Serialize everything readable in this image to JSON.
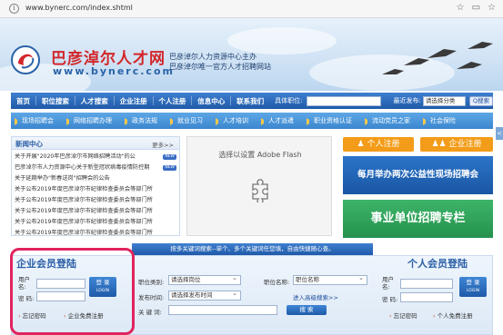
{
  "browser": {
    "url": "www.bynerc.com/index.shtml"
  },
  "header": {
    "logo_cn": "巴彦淖尔人才网",
    "logo_url": "www.bynerc.com",
    "tagline_1": "巴彦淖尔人力资源中心主办",
    "tagline_2": "巴彦淖尔唯一官方人才招聘网站"
  },
  "main_nav": {
    "items": [
      "首页",
      "职位搜索",
      "人才搜索",
      "企业注册",
      "个人注册",
      "信息中心",
      "联系我们"
    ],
    "position_label": "具体职位:",
    "date_label": "最近发布:",
    "category_select": "请选择分类",
    "search_btn": "Q搜索"
  },
  "sub_nav": {
    "items": [
      "现场招聘会",
      "网络招聘办理",
      "政务法规",
      "就业见习",
      "人才培训",
      "人才派遣",
      "职业资格认证",
      "流动党员之家",
      "社会保险"
    ]
  },
  "news": {
    "title": "新闻中心",
    "more": "更多>>",
    "items": [
      {
        "text": "关于开展\"2020年巴彦淖尔市网络招聘活动\"的公",
        "new": "NEW"
      },
      {
        "text": "巴彦淖尔市人力资源中心关于新型冠状病毒疫情防控期",
        "new": "NEW"
      },
      {
        "text": "关于延期举办\"新春送岗\"招聘会的公告",
        "new": ""
      },
      {
        "text": "关于公布2019年度巴彦淖尔市纪律检查委员会等部门所",
        "new": ""
      },
      {
        "text": "关于公布2019年度巴彦淖尔市纪律检查委员会等部门所",
        "new": ""
      },
      {
        "text": "关于公布2019年度巴彦淖尔市纪律检查委员会等部门所",
        "new": ""
      },
      {
        "text": "关于公布2019年度巴彦淖尔市纪律检查委员会等部门所",
        "new": ""
      },
      {
        "text": "关于公布2019年度巴彦淖尔市纪律检查委员会等部门所",
        "new": ""
      }
    ]
  },
  "flash": {
    "text": "选择以设置 Adobe Flash"
  },
  "promos": {
    "personal_register": "个人注册",
    "company_register": "企业注册",
    "fair_banner": "每月举办两次公益性现场招聘会",
    "public_banner": "事业单位招聘专栏"
  },
  "search_strip": "按多关键词搜索--单个、多个关键词任您填，自由快捷随心查。",
  "corp_login": {
    "title": "企业会员登陆",
    "user_label_1": "用户",
    "user_label_2": "名:",
    "pass_label": "密 码:",
    "login_btn": "登 录",
    "login_btn_en": "LOGIN",
    "forgot": "忘记密码",
    "register": "企业免费注册"
  },
  "search_form": {
    "job_type_label": "职位类别:",
    "job_type_value": "请选择岗位",
    "job_name_label": "职位名称:",
    "job_name_value": "职位名称",
    "time_label": "发布时间:",
    "time_value": "请选择发布时间",
    "advanced": "进入高级搜索>>",
    "keyword_label": "关 键 词:",
    "submit": "搜 索"
  },
  "personal_login": {
    "title": "个人会员登陆",
    "user_label_1": "用户",
    "user_label_2": "名:",
    "pass_label": "密 码:",
    "login_btn": "登 录",
    "login_btn_en": "LOGIN",
    "forgot": "忘记密码",
    "register": "个人免费注册"
  }
}
